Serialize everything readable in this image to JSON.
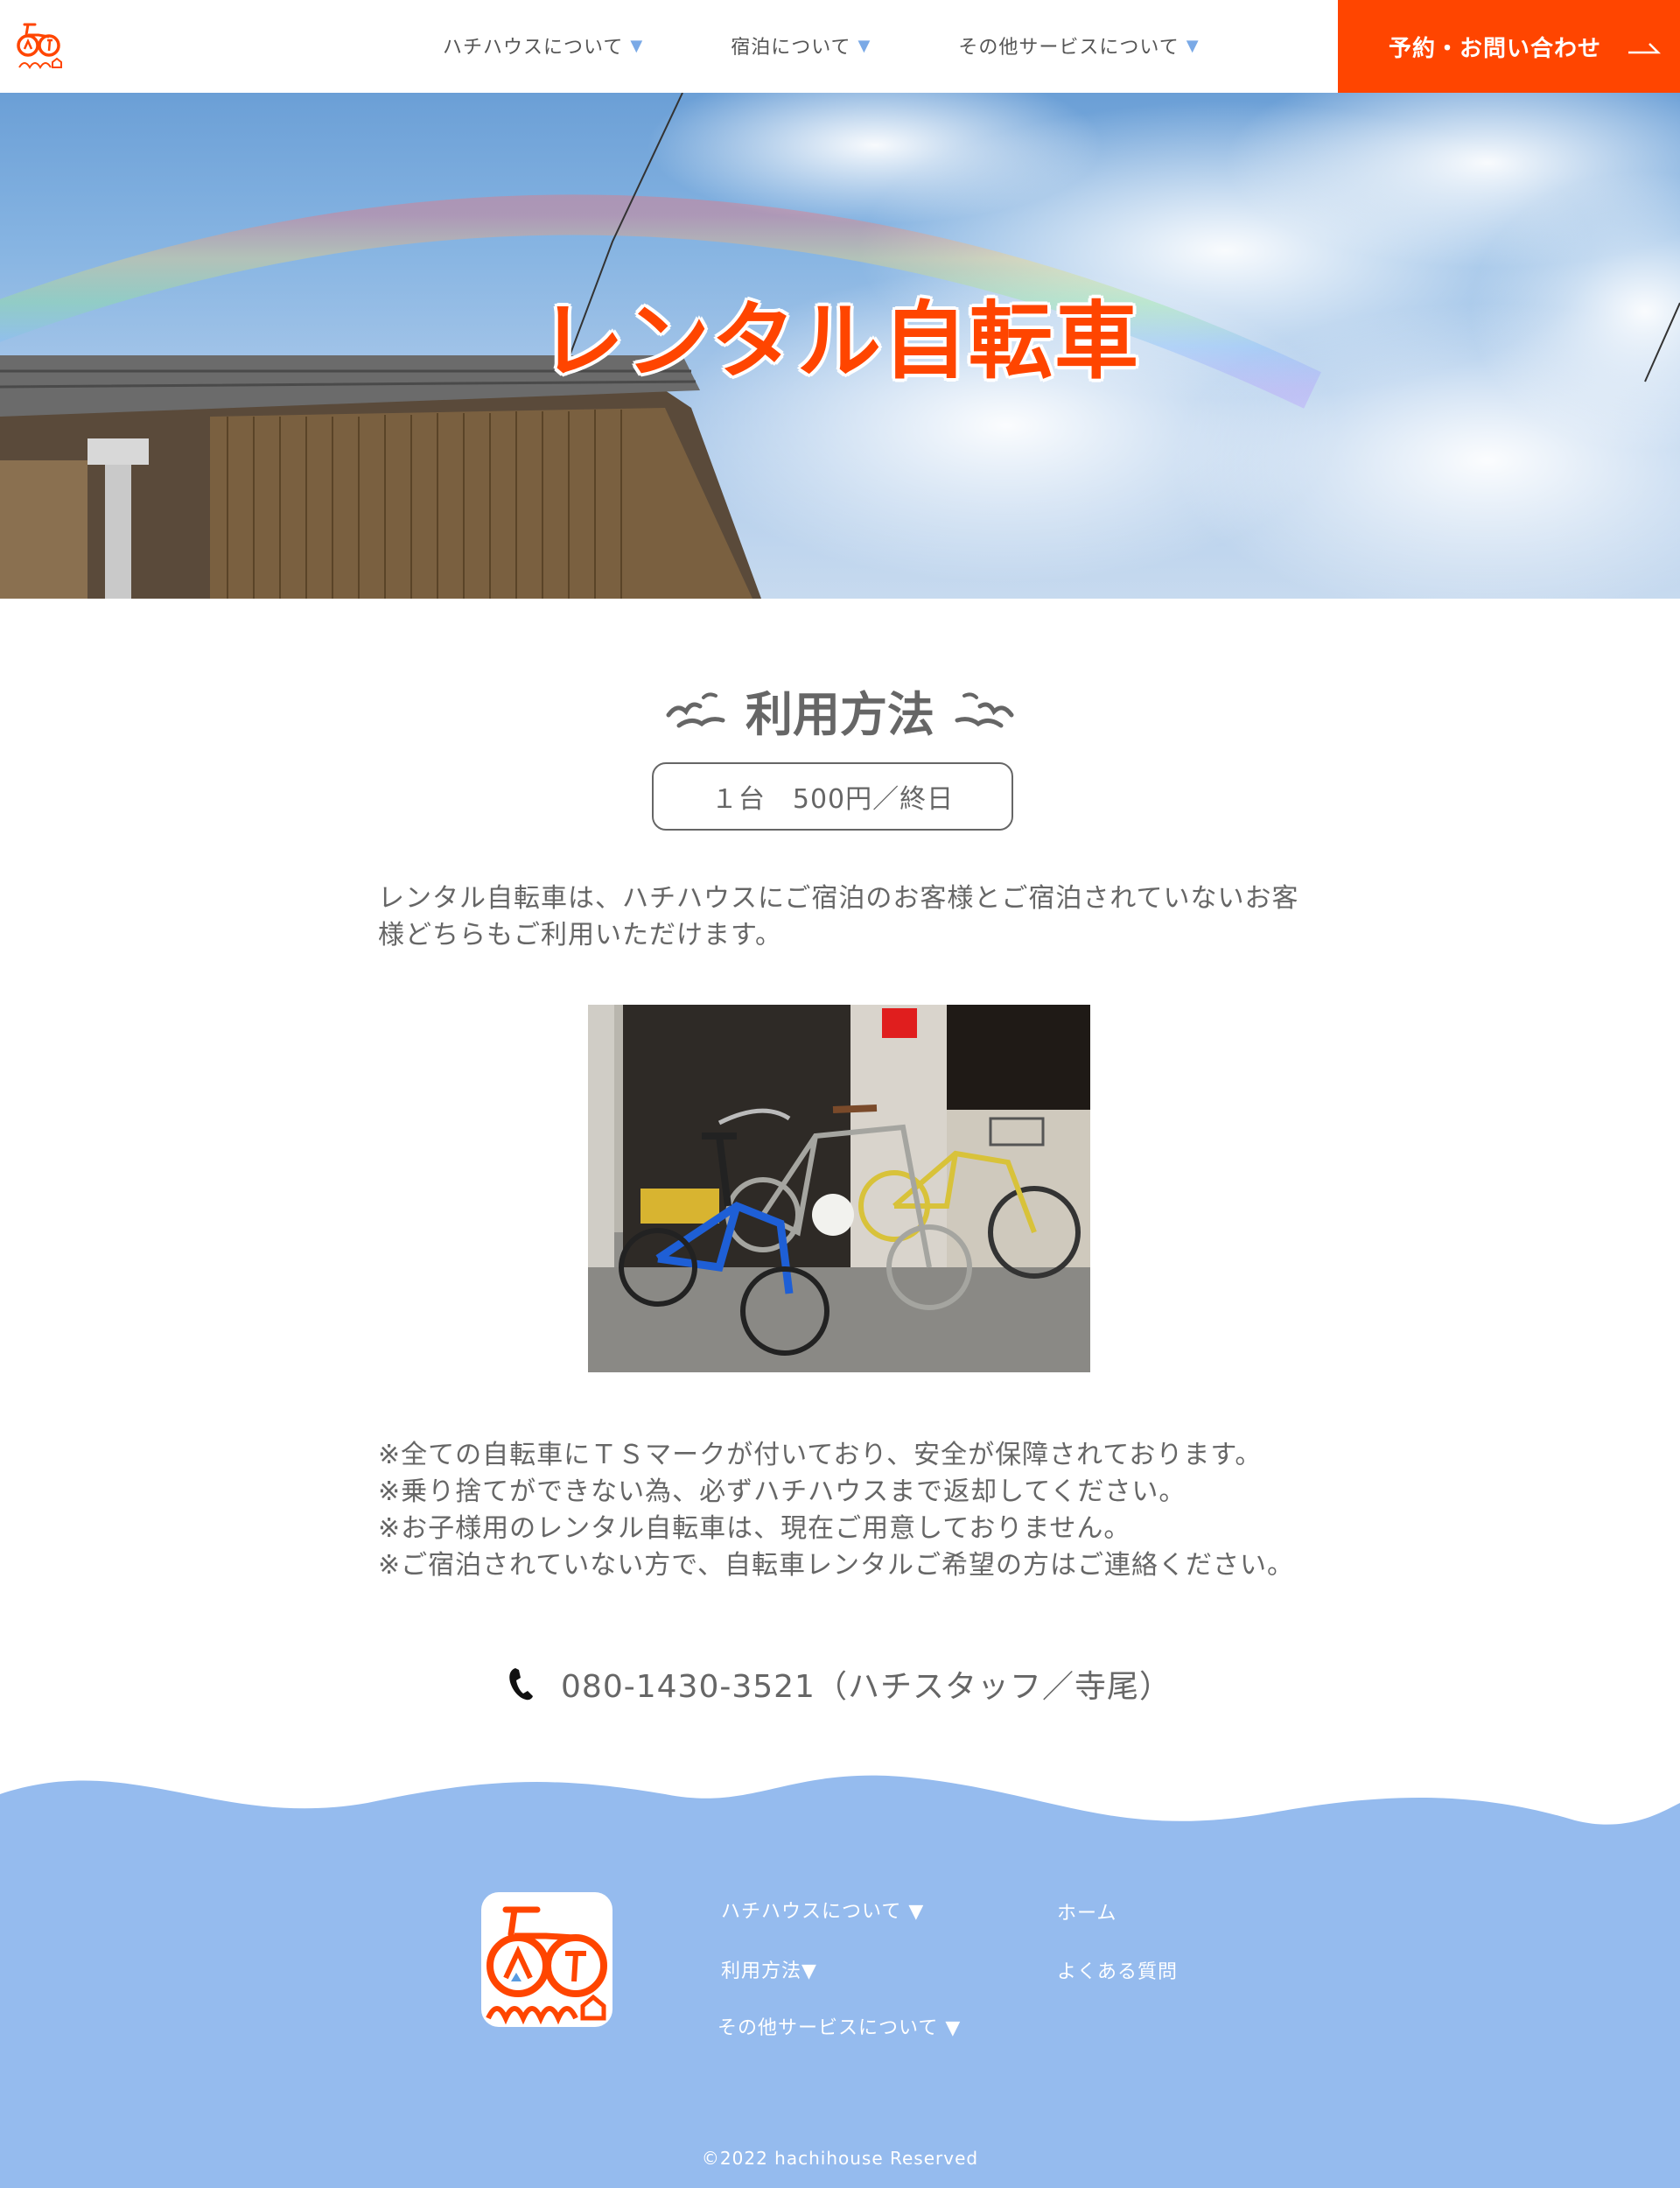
{
  "header": {
    "logo_text": "ハチ house",
    "nav": [
      {
        "label": "ハチハウスについて",
        "arrow": "▼"
      },
      {
        "label": "宿泊について",
        "arrow": "▼"
      },
      {
        "label": "その他サービスについて",
        "arrow": "▼"
      }
    ],
    "cta_label": "予約・お問い合わせ"
  },
  "hero": {
    "title": "レンタル自転車"
  },
  "usage": {
    "title": "利用方法",
    "price": "１台　500円／終日",
    "intro": "レンタル自転車は、ハチハウスにご宿泊のお客様とご宿泊されていないお客様どちらもご利用いただけます。",
    "notes": [
      "※全ての自転車にＴＳマークが付いており、安全が保障されております。",
      "※乗り捨てができない為、必ずハチハウスまで返却してください。",
      "※お子様用のレンタル自転車は、現在ご用意しておりません。",
      "※ご宿泊されていない方で、自転車レンタルご希望の方はご連絡ください。"
    ],
    "phone": "080-1430-3521（ハチスタッフ／寺尾）"
  },
  "footer": {
    "links_col1": [
      "ハチハウスについて ▼",
      "利用方法▼",
      "その他サービスについて ▼"
    ],
    "links_col2": [
      "ホーム",
      "よくある質問"
    ],
    "copyright": "©2022 hachihouse Reserved"
  },
  "colors": {
    "accent": "#ff4500",
    "footer_bg": "#95bbee",
    "text": "#666666",
    "nav_arrow": "#7aa9e6"
  },
  "icons": [
    "bicycle-logo-icon",
    "bird-icon",
    "phone-icon",
    "arrow-right-icon"
  ]
}
